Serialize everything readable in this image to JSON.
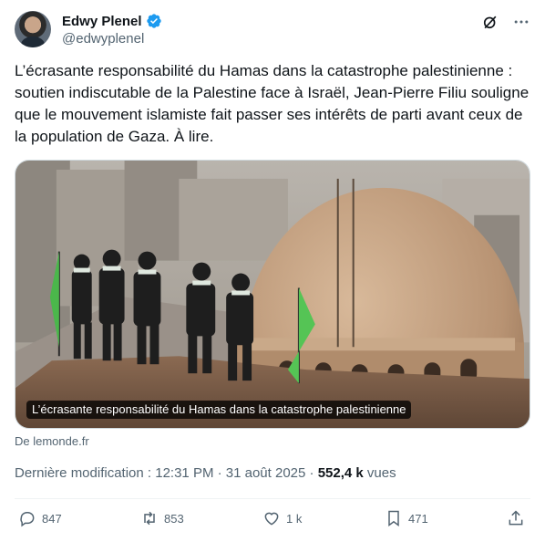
{
  "author": {
    "display_name": "Edwy Plenel",
    "handle": "@edwyplenel",
    "verified": true
  },
  "header_icons": [
    "grok-icon",
    "more-icon"
  ],
  "tweet": {
    "text": "L’écrasante responsabilité du Hamas dans la catastrophe palestinienne : soutien indiscutable de la Palestine face à Israël, Jean-Pierre Filiu souligne que le mouvement islamiste fait passer ses intérêts de parti avant ceux de la population de Gaza. À lire."
  },
  "card": {
    "caption": "L’écrasante responsabilité du Hamas dans la catastrophe palestinienne",
    "source": "De lemonde.fr"
  },
  "meta": {
    "prefix": "Dernière modification : 12:31 PM · 31 août 2025 · ",
    "views_count": "552,4 k",
    "views_label": " vues"
  },
  "actions": {
    "replies": "847",
    "reposts": "853",
    "likes": "1 k",
    "bookmarks": "471"
  },
  "colors": {
    "text": "#0f1419",
    "secondary": "#536471",
    "verified": "#1d9bf0",
    "border": "#cfd9de"
  }
}
